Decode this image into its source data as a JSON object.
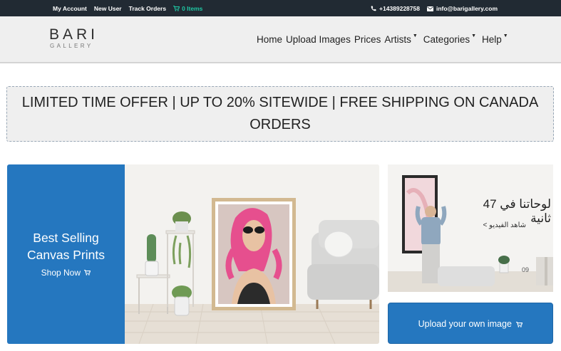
{
  "topbar": {
    "links": [
      "My Account",
      "New User",
      "Track Orders"
    ],
    "cart_label": "0 Items",
    "phone": "+14389228758",
    "email": "info@barigallery.com"
  },
  "logo": {
    "brand": "BARI",
    "sub": "GALLERY"
  },
  "nav": {
    "items": [
      {
        "label": "Home",
        "dropdown": false
      },
      {
        "label": "Upload Images",
        "dropdown": false
      },
      {
        "label": "Prices",
        "dropdown": false
      },
      {
        "label": "Artists",
        "dropdown": true
      },
      {
        "label": "Categories",
        "dropdown": true
      },
      {
        "label": "Help",
        "dropdown": true
      }
    ]
  },
  "offer": {
    "line1": "LIMITED TIME OFFER | UP TO 20% SITEWIDE | FREE SHIPPING ON CANADA",
    "line2": "ORDERS"
  },
  "hero": {
    "title_line1": "Best Selling",
    "title_line2": "Canvas Prints",
    "shop_label": "Shop Now",
    "video_title": "لوحاتنا في 47 ثانية",
    "video_sub": "شاهد الفيديو >",
    "clock_text": "09"
  },
  "upload": {
    "label": "Upload your own image"
  },
  "colors": {
    "topbar": "#212a33",
    "accent": "#2577bf",
    "cart": "#1fc6a3"
  }
}
